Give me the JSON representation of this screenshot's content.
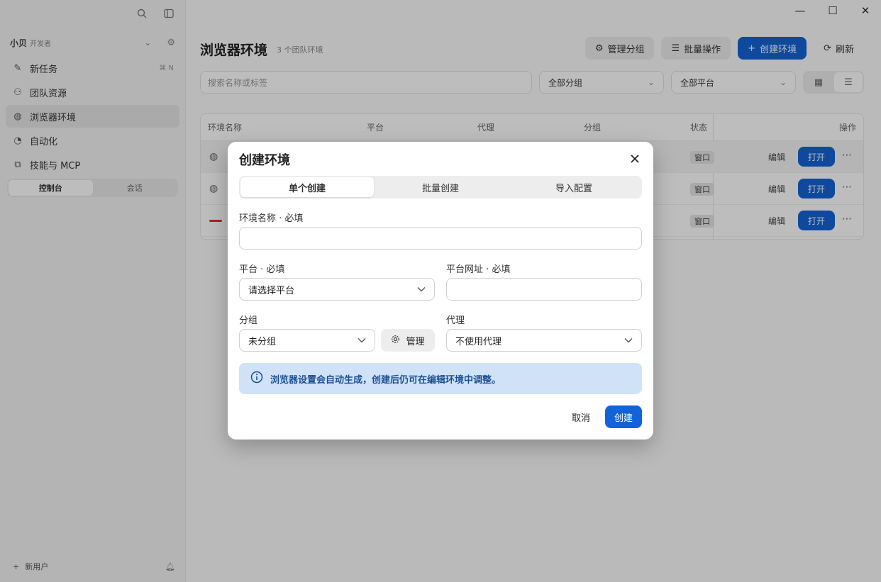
{
  "sidebar": {
    "workspace_name": "小贝",
    "workspace_role": "开发者",
    "items": [
      {
        "label": "新任务",
        "shortcut": "⌘ N"
      },
      {
        "label": "团队资源",
        "shortcut": ""
      },
      {
        "label": "浏览器环境",
        "shortcut": ""
      },
      {
        "label": "自动化",
        "shortcut": ""
      },
      {
        "label": "技能与 MCP",
        "shortcut": ""
      }
    ],
    "segment": [
      "控制台",
      "会话"
    ],
    "user": "新用户"
  },
  "window_controls": [
    "—",
    "☐",
    "✕"
  ],
  "main": {
    "title": "浏览器环境",
    "subtitle": "3 个团队环境",
    "toolbar": {
      "manage_groups": "管理分组",
      "batch": "批量操作",
      "create": "创建环境",
      "refresh": "刷新"
    },
    "search_placeholder": "搜索名称或标签",
    "filter_group": "全部分组",
    "filter_platform": "全部平台",
    "table": {
      "headers": [
        "环境名称",
        "平台",
        "代理",
        "分组",
        "状态",
        "操作"
      ],
      "rows": [
        {
          "status": "窗口",
          "edit": "编辑",
          "open": "打开"
        },
        {
          "status": "窗口",
          "edit": "编辑",
          "open": "打开"
        },
        {
          "status": "窗口",
          "edit": "编辑",
          "open": "打开"
        }
      ]
    }
  },
  "dialog": {
    "title": "创建环境",
    "tabs": [
      "单个创建",
      "批量创建",
      "导入配置"
    ],
    "name_label": "环境名称 · 必填",
    "name_value": "",
    "platform_label": "平台 · 必填",
    "platform_value": "请选择平台",
    "platform_url_label": "平台网址 · 必填",
    "platform_url_value": "",
    "group_label": "分组",
    "group_value": "未分组",
    "manage_label": "管理",
    "proxy_label": "代理",
    "proxy_value": "不使用代理",
    "info_text": "浏览器设置会自动生成，创建后仍可在编辑环境中调整。",
    "cancel_label": "取消",
    "create_label": "创建"
  },
  "colors": {
    "accent": "#1463d6",
    "info_bg": "#cfe2f8",
    "info_text": "#1b4f92"
  }
}
